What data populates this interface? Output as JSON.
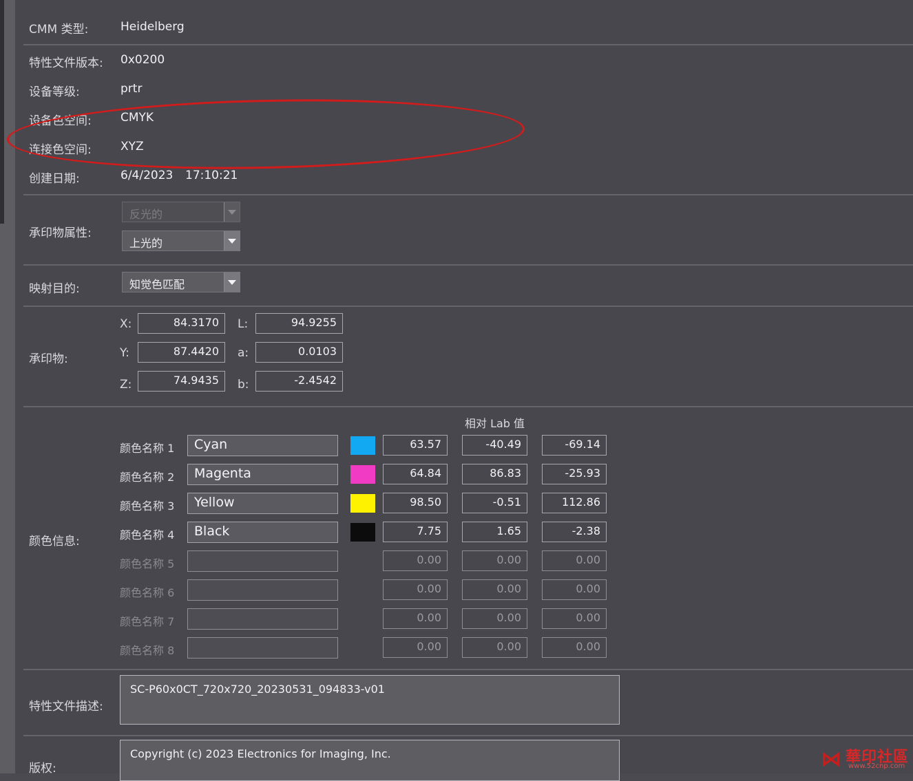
{
  "header": {
    "cmm_label": "CMM 类型:",
    "cmm_value": "Heidelberg"
  },
  "profile": {
    "version_label": "特性文件版本:",
    "version_value": "0x0200",
    "class_label": "设备等级:",
    "class_value": "prtr",
    "device_space_label": "设备色空间:",
    "device_space_value": "CMYK",
    "pcs_label": "连接色空间:",
    "pcs_value": "XYZ",
    "date_label": "创建日期:",
    "date_value": "6/4/2023",
    "time_value": "17:10:21"
  },
  "media": {
    "label": "承印物属性:",
    "reflective": "反光的",
    "glossy": "上光的"
  },
  "intent": {
    "label": "映射目的:",
    "value": "知觉色匹配"
  },
  "substrate": {
    "label": "承印物:",
    "x_label": "X:",
    "x": "84.3170",
    "y_label": "Y:",
    "y": "87.4420",
    "z_label": "Z:",
    "z": "74.9435",
    "l_label": "L:",
    "l": "94.9255",
    "a_label": "a:",
    "a": "0.0103",
    "b_label": "b:",
    "b": "-2.4542"
  },
  "colors": {
    "label": "颜色信息:",
    "lab_header": "相对 Lab 值",
    "rows": [
      {
        "label": "颜色名称 1",
        "name": "Cyan",
        "swatch": "#12a9f2",
        "L": "63.57",
        "a": "-40.49",
        "b": "-69.14"
      },
      {
        "label": "颜色名称 2",
        "name": "Magenta",
        "swatch": "#f23bc4",
        "L": "64.84",
        "a": "86.83",
        "b": "-25.93"
      },
      {
        "label": "颜色名称 3",
        "name": "Yellow",
        "swatch": "#fff200",
        "L": "98.50",
        "a": "-0.51",
        "b": "112.86"
      },
      {
        "label": "颜色名称 4",
        "name": "Black",
        "swatch": "#0c0c0c",
        "L": "7.75",
        "a": "1.65",
        "b": "-2.38"
      },
      {
        "label": "颜色名称 5",
        "name": "",
        "L": "0.00",
        "a": "0.00",
        "b": "0.00"
      },
      {
        "label": "颜色名称 6",
        "name": "",
        "L": "0.00",
        "a": "0.00",
        "b": "0.00"
      },
      {
        "label": "颜色名称 7",
        "name": "",
        "L": "0.00",
        "a": "0.00",
        "b": "0.00"
      },
      {
        "label": "颜色名称 8",
        "name": "",
        "L": "0.00",
        "a": "0.00",
        "b": "0.00"
      }
    ]
  },
  "description": {
    "label": "特性文件描述:",
    "value": "SC-P60x0CT_720x720_20230531_094833-v01"
  },
  "copyright": {
    "label": "版权:",
    "value": "Copyright (c) 2023 Electronics for Imaging, Inc."
  },
  "watermark": {
    "title": "華印社區",
    "url": "www.52cnp.com"
  }
}
